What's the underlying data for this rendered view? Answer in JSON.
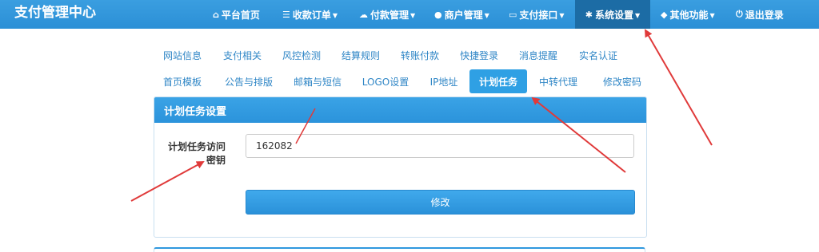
{
  "brand": "支付管理中心",
  "nav": [
    {
      "icon": "home-icon",
      "glyph": "⌂",
      "label": "平台首页",
      "caret": false
    },
    {
      "icon": "list-icon",
      "glyph": "☰",
      "label": "收款订单",
      "caret": true
    },
    {
      "icon": "cloud-icon",
      "glyph": "☁",
      "label": "付款管理",
      "caret": true
    },
    {
      "icon": "user-icon",
      "glyph": "●",
      "label": "商户管理",
      "caret": true
    },
    {
      "icon": "card-icon",
      "glyph": "▭",
      "label": "支付接口",
      "caret": true
    },
    {
      "icon": "gear-icon",
      "glyph": "✱",
      "label": "系统设置",
      "caret": true
    },
    {
      "icon": "cube-icon",
      "glyph": "◆",
      "label": "其他功能",
      "caret": true
    },
    {
      "icon": "power-icon",
      "glyph": "⏻",
      "label": "退出登录",
      "caret": false
    }
  ],
  "tabs_row1": [
    "网站信息",
    "支付相关",
    "风控检测",
    "结算规则",
    "转账付款",
    "快捷登录",
    "消息提醒",
    "实名认证"
  ],
  "tabs_row2": [
    "首页模板",
    "公告与排版",
    "邮箱与短信",
    "LOGO设置",
    "IP地址",
    "计划任务",
    "中转代理",
    "修改密码"
  ],
  "panel": {
    "title": "计划任务设置",
    "field_label": "计划任务访问密钥",
    "field_value": "162082",
    "submit_label": "修改"
  },
  "colors": {
    "navbar": "#2b8fd6",
    "active": "#1c6ca5",
    "accent": "#2fa0e4",
    "annotation": "#e03a3a"
  }
}
